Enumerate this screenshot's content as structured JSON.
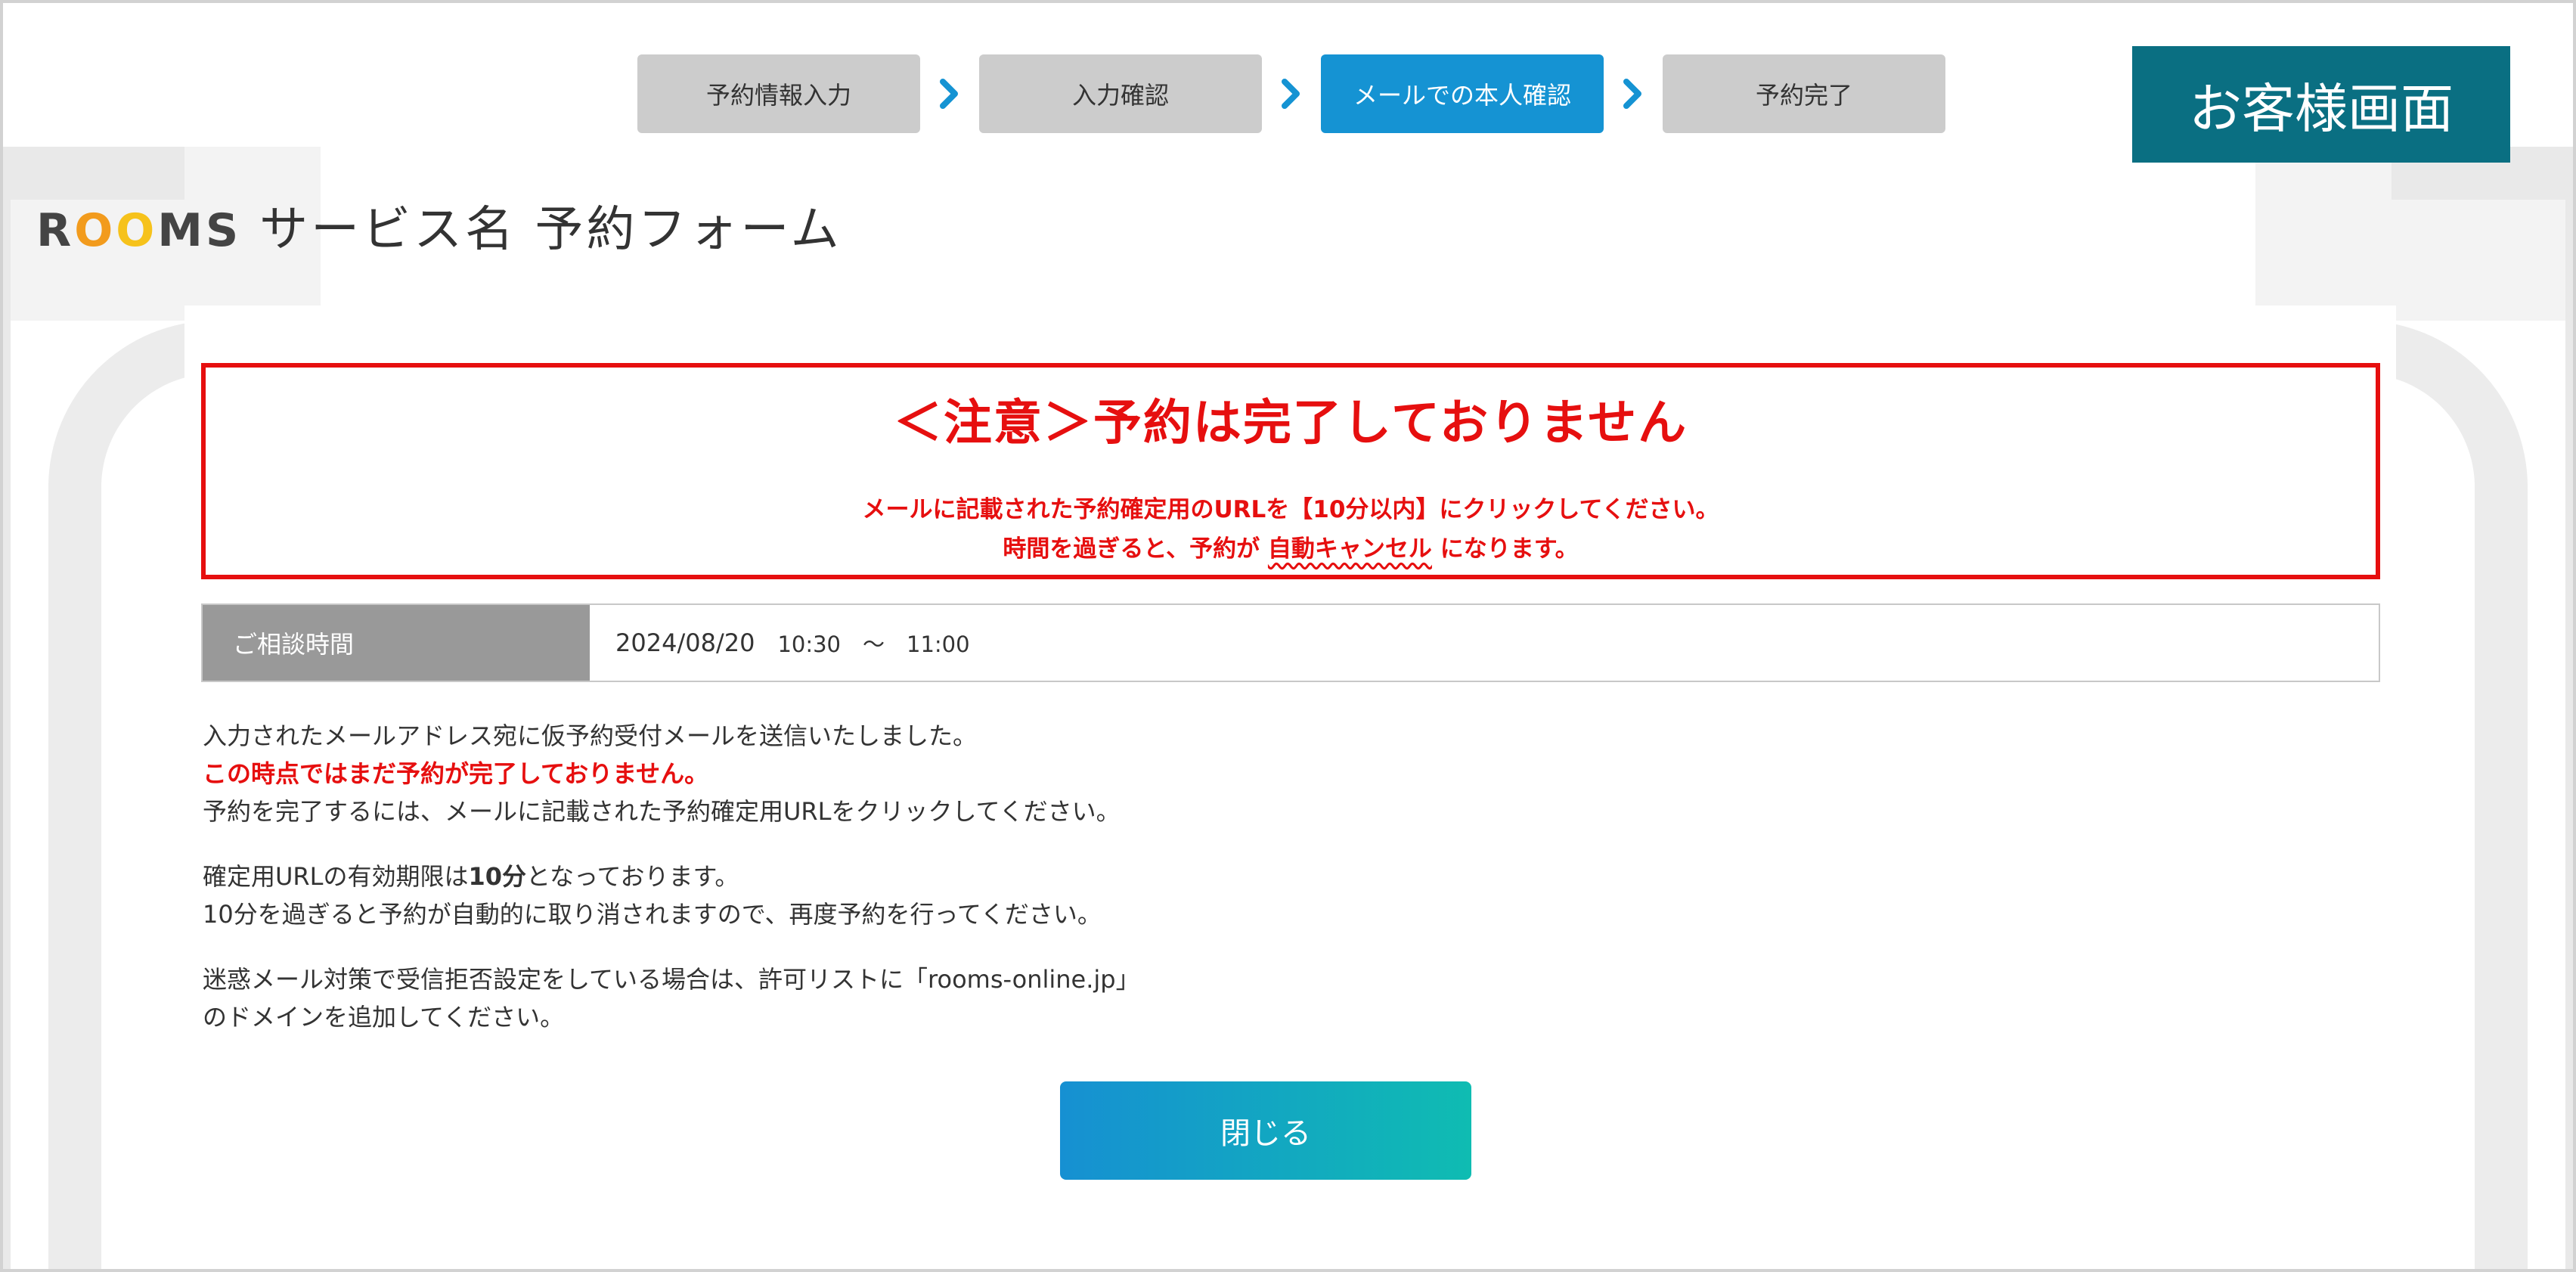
{
  "steps": [
    "予約情報入力",
    "入力確認",
    "メールでの本人確認",
    "予約完了"
  ],
  "badge": "お客様画面",
  "logo": {
    "r": "R",
    "o1": "O",
    "o2": "O",
    "ms": "MS"
  },
  "service_title": "サービス名 予約フォーム",
  "warning": {
    "title": "＜注意＞予約は完了しておりません",
    "line1": "メールに記載された予約確定用のURLを【10分以内】にクリックしてください。",
    "line2_pre": "時間を過ぎると、予約が ",
    "line2_em": "自動キャンセル",
    "line2_post": " になります。"
  },
  "consult": {
    "label": "ご相談時間",
    "date": "2024/08/20",
    "range": "10:30　～　11:00"
  },
  "message": {
    "p1_line1": "入力されたメールアドレス宛に仮予約受付メールを送信いたしました。",
    "p1_line2": "この時点ではまだ予約が完了しておりません。",
    "p1_line3": "予約を完了するには、メールに記載された予約確定用URLをクリックしてください。",
    "p2_pre": "確定用URLの有効期限は",
    "p2_bold": "10分",
    "p2_post": "となっております。",
    "p2_line2": "10分を過ぎると予約が自動的に取り消されますので、再度予約を行ってください。",
    "p3_line1": "迷惑メール対策で受信拒否設定をしている場合は、許可リストに「rooms-online.jp」",
    "p3_line2": "のドメインを追加してください。"
  },
  "close_label": "閉じる",
  "colors": {
    "accent": "#1593d3",
    "badge": "#0a6f82",
    "warning": "#e60f0f",
    "step_inactive": "#cccccc"
  }
}
